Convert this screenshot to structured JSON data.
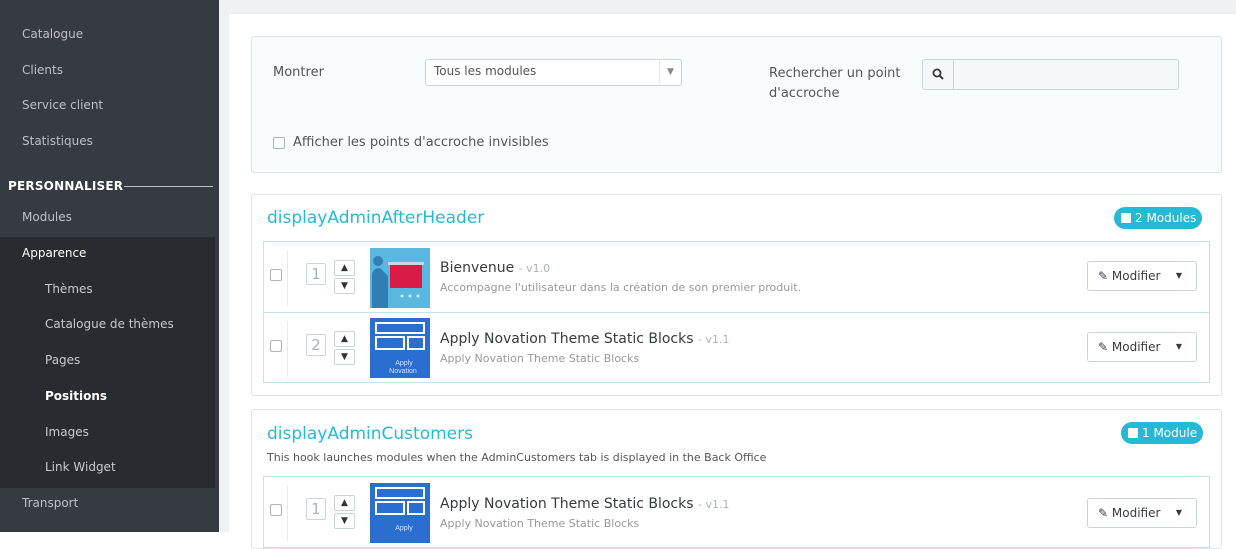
{
  "sidebar": {
    "items_top": [
      "Catalogue",
      "Clients",
      "Service client",
      "Statistiques"
    ],
    "section": "PERSONNALISER",
    "modules": "Modules",
    "apparence": "Apparence",
    "sub_items": [
      "Thèmes",
      "Catalogue de thèmes",
      "Pages",
      "Positions",
      "Images",
      "Link Widget"
    ],
    "transport": "Transport"
  },
  "filters": {
    "show_label": "Montrer",
    "select_value": "Tous les modules",
    "search_label_1": "Rechercher un point",
    "search_label_2": "d'accroche",
    "checkbox_label": "Afficher les points d'accroche invisibles"
  },
  "hooks": [
    {
      "title": "displayAdminAfterHeader",
      "badge": "2 Modules",
      "modules": [
        {
          "position": "1",
          "name": "Bienvenue",
          "version": "- v1.0",
          "description": "Accompagne l'utilisateur dans la création de son premier produit.",
          "button": "Modifier"
        },
        {
          "position": "2",
          "name": "Apply Novation Theme Static Blocks",
          "version": "- v1.1",
          "description": "Apply Novation Theme Static Blocks",
          "button": "Modifier",
          "logo_text_1": "Apply",
          "logo_text_2": "Novation"
        }
      ]
    },
    {
      "title": "displayAdminCustomers",
      "description": "This hook launches modules when the AdminCustomers tab is displayed in the Back Office",
      "badge": "1 Module",
      "modules": [
        {
          "position": "1",
          "name": "Apply Novation Theme Static Blocks",
          "version": "- v1.1",
          "description": "Apply Novation Theme Static Blocks",
          "button": "Modifier",
          "logo_text_1": "Apply"
        }
      ]
    }
  ],
  "colors": {
    "accent": "#25b9d7",
    "sidebar": "#363a41"
  }
}
